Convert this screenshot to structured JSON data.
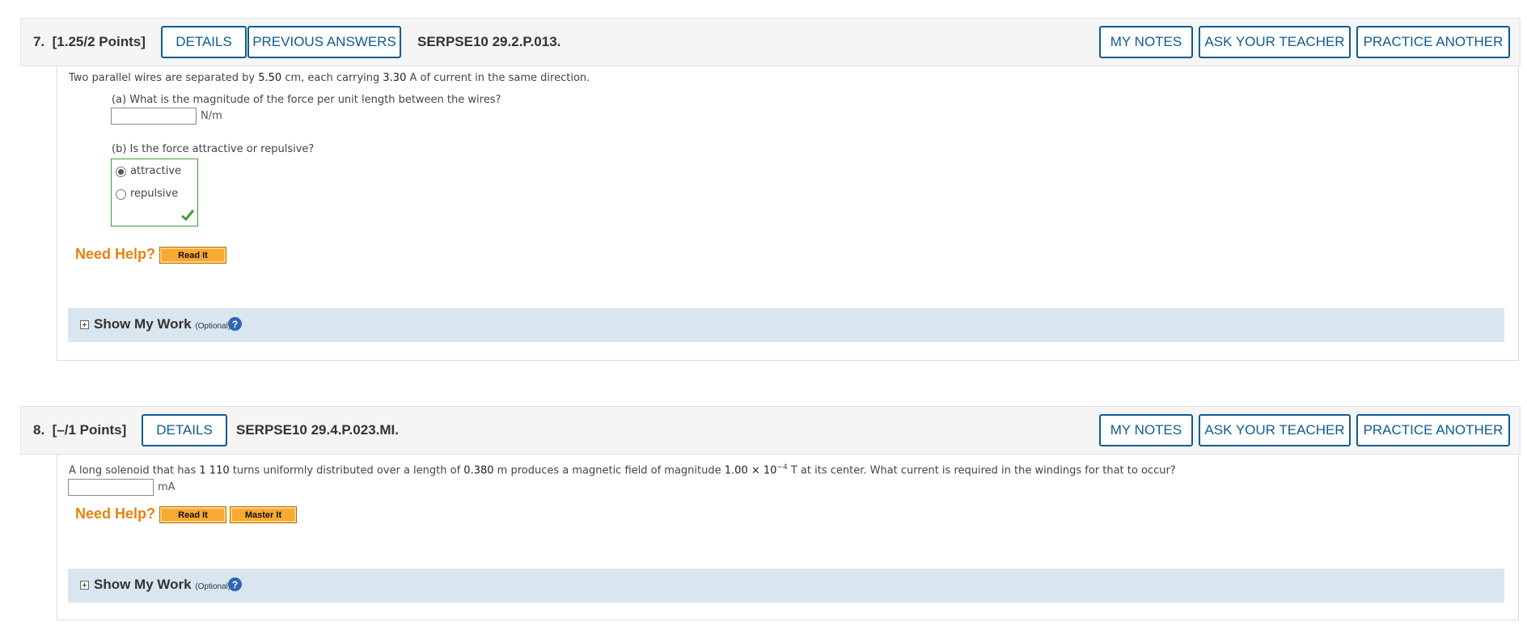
{
  "q7": {
    "number": "7.",
    "points": "[1.25/2 Points]",
    "details_label": "DETAILS",
    "previous_answers_label": "PREVIOUS ANSWERS",
    "code": "SERPSE10 29.2.P.013.",
    "my_notes_label": "MY NOTES",
    "ask_teacher_label": "ASK YOUR TEACHER",
    "practice_another_label": "PRACTICE ANOTHER",
    "prompt": {
      "before_sep": "Two parallel wires are separated by ",
      "separation": "5.50",
      "after_sep": " cm, each carrying ",
      "current": "3.30",
      "after_current": " A of current in the same direction."
    },
    "part_a": {
      "question": "(a) What is the magnitude of the force per unit length between the wires?",
      "value": "",
      "unit": "N/m"
    },
    "part_b": {
      "question": "(b) Is the force attractive or repulsive?",
      "options": [
        "attractive",
        "repulsive"
      ],
      "selected": "attractive",
      "status": "correct"
    },
    "need_help": "Need Help?",
    "read_it_label": "Read It",
    "show_my_work": "Show My Work",
    "optional": "(Optional)",
    "help_icon": "?"
  },
  "q8": {
    "number": "8.",
    "points": "[–/1 Points]",
    "details_label": "DETAILS",
    "code": "SERPSE10 29.4.P.023.MI.",
    "my_notes_label": "MY NOTES",
    "ask_teacher_label": "ASK YOUR TEACHER",
    "practice_another_label": "PRACTICE ANOTHER",
    "prompt": {
      "before_turns": "A long solenoid that has ",
      "turns": "1 110",
      "after_turns": " turns uniformly distributed over a length of ",
      "length": "0.380",
      "after_length": " m produces a magnetic field of magnitude ",
      "field_mantissa": "1.00",
      "times": " × 10",
      "field_exponent": "−4",
      "after_field": " T at its center. What current is required in the windings for that to occur?"
    },
    "answer": {
      "value": "",
      "unit": "mA"
    },
    "need_help": "Need Help?",
    "read_it_label": "Read It",
    "master_it_label": "Master It",
    "show_my_work": "Show My Work",
    "optional": "(Optional)",
    "help_icon": "?"
  },
  "colors": {
    "accent_blue": "#0d5c91",
    "need_help_orange": "#e8810f",
    "correct_green": "#3aa03a",
    "show_work_bg": "#d9e6f0"
  }
}
